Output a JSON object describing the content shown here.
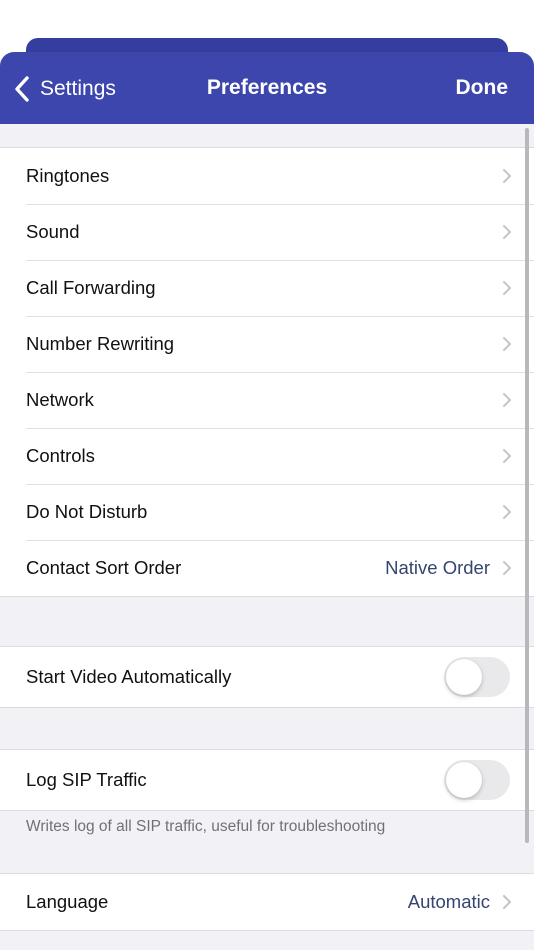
{
  "nav": {
    "back_label": "Settings",
    "title": "Preferences",
    "done_label": "Done"
  },
  "main_group": {
    "items": [
      {
        "label": "Ringtones"
      },
      {
        "label": "Sound"
      },
      {
        "label": "Call Forwarding"
      },
      {
        "label": "Number Rewriting"
      },
      {
        "label": "Network"
      },
      {
        "label": "Controls"
      },
      {
        "label": "Do Not Disturb"
      },
      {
        "label": "Contact Sort Order",
        "value": "Native Order"
      }
    ]
  },
  "video_group": {
    "label": "Start Video Automatically",
    "enabled": false
  },
  "sip_group": {
    "label": "Log SIP Traffic",
    "enabled": false,
    "footer": "Writes log of all SIP traffic, useful for troubleshooting"
  },
  "language_group": {
    "label": "Language",
    "value": "Automatic"
  },
  "colors": {
    "nav_bar": "#3c46ad",
    "value_text": "#34456f",
    "background": "#f2f2f6"
  }
}
